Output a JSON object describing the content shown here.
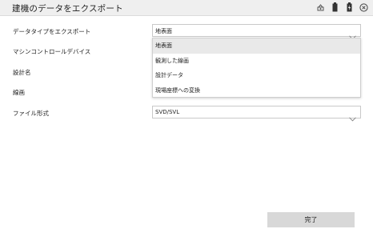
{
  "window": {
    "title": "建機のデータをエクスポート",
    "icons": [
      "network-icon",
      "battery-icon",
      "battery-charging-icon",
      "close-icon"
    ]
  },
  "form": {
    "data_type": {
      "label": "データタイプをエクスポート",
      "value": "地表面"
    },
    "machine_control_device": {
      "label": "マシンコントロールデバイス"
    },
    "design_name": {
      "label": "設計名"
    },
    "linework": {
      "label": "線画"
    },
    "file_format": {
      "label": "ファイル形式",
      "value": "SVD/SVL"
    }
  },
  "dropdown": {
    "options": [
      "地表面",
      "観測した線画",
      "設計データ",
      "現場座標への変換"
    ],
    "selected_index": 0
  },
  "footer": {
    "done_label": "完了"
  }
}
